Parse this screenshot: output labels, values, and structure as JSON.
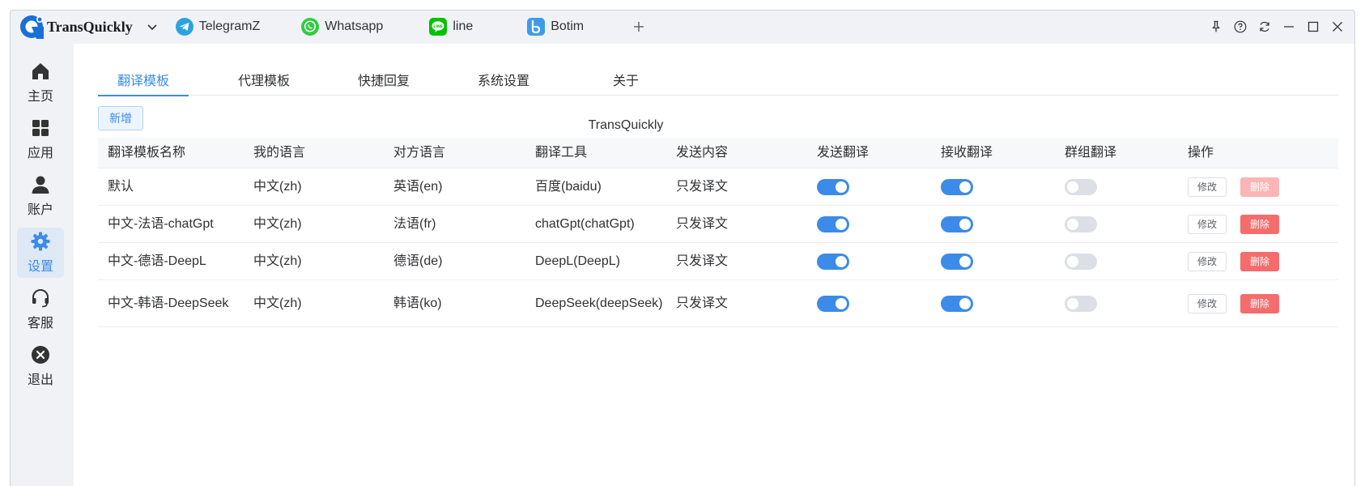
{
  "app": {
    "name": "TransQuickly",
    "brand_color": "#1a6fd9"
  },
  "app_tabs": [
    {
      "label": "TelegramZ",
      "icon": "telegram-icon",
      "color": "#2aa3e0"
    },
    {
      "label": "Whatsapp",
      "icon": "whatsapp-icon",
      "color": "#2ecc40"
    },
    {
      "label": "line",
      "icon": "line-icon",
      "color": "#00c300"
    },
    {
      "label": "Botim",
      "icon": "botim-icon",
      "color": "#3d9be9"
    }
  ],
  "sidebar": {
    "items": [
      {
        "label": "主页",
        "icon": "home-icon"
      },
      {
        "label": "应用",
        "icon": "grid-icon"
      },
      {
        "label": "账户",
        "icon": "user-icon"
      },
      {
        "label": "设置",
        "icon": "gear-icon",
        "active": true
      },
      {
        "label": "客服",
        "icon": "headset-icon"
      },
      {
        "label": "退出",
        "icon": "close-circle-icon"
      }
    ]
  },
  "settings_tabs": [
    "翻译模板",
    "代理模板",
    "快捷回复",
    "系统设置",
    "关于TransQuickly"
  ],
  "add_button": "新增",
  "table": {
    "columns": [
      "翻译模板名称",
      "我的语言",
      "对方语言",
      "翻译工具",
      "发送内容",
      "发送翻译",
      "接收翻译",
      "群组翻译",
      "操作"
    ],
    "edit_label": "修改",
    "delete_label": "删除",
    "rows": [
      {
        "name": "默认",
        "my_lang": "中文(zh)",
        "other_lang": "英语(en)",
        "tool": "百度(baidu)",
        "content": "只发译文",
        "send": true,
        "receive": true,
        "group": false,
        "delete_disabled": true
      },
      {
        "name": "中文-法语-chatGpt",
        "my_lang": "中文(zh)",
        "other_lang": "法语(fr)",
        "tool": "chatGpt(chatGpt)",
        "content": "只发译文",
        "send": true,
        "receive": true,
        "group": false,
        "delete_disabled": false
      },
      {
        "name": "中文-德语-DeepL",
        "my_lang": "中文(zh)",
        "other_lang": "德语(de)",
        "tool": "DeepL(DeepL)",
        "content": "只发译文",
        "send": true,
        "receive": true,
        "group": false,
        "delete_disabled": false
      },
      {
        "name": "中文-韩语-DeepSeek",
        "my_lang": "中文(zh)",
        "other_lang": "韩语(ko)",
        "tool": "DeepSeek(deepSeek)",
        "content": "只发译文",
        "send": true,
        "receive": true,
        "group": false,
        "delete_disabled": false
      }
    ]
  },
  "colors": {
    "accent": "#3c8be8",
    "danger": "#f56c6c",
    "danger_disabled": "#fab6b6",
    "switch_off": "#dcdfe6"
  }
}
